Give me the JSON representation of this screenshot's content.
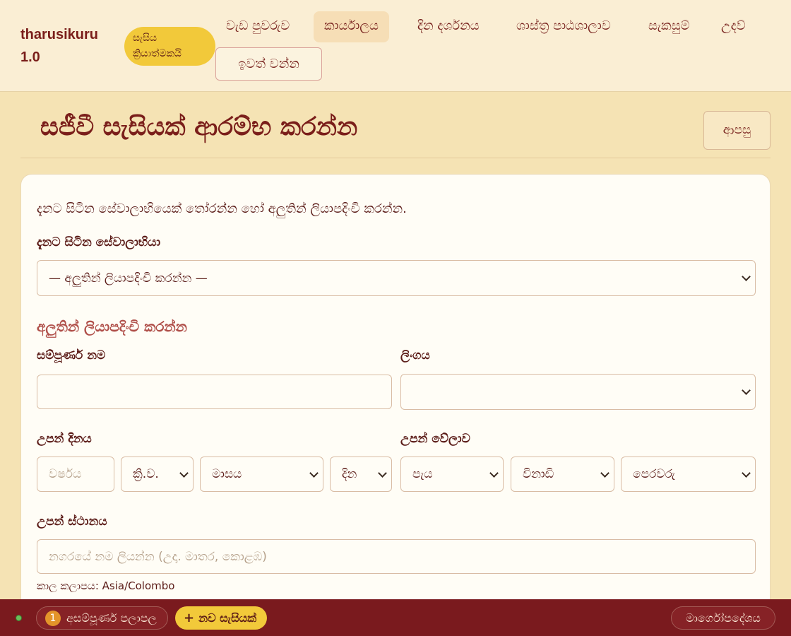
{
  "app": {
    "brand": "tharusikuru 1.0",
    "session_badge": "සැසිය ක්‍රියාත්මකයි"
  },
  "nav": {
    "items": [
      {
        "label": "වැඩ පුවරුව"
      },
      {
        "label": "කාර්යාලය",
        "active": true
      },
      {
        "label": "දින දර්ශනය"
      },
      {
        "label": "ශාස්ත්‍ර පාඨශාලාව"
      },
      {
        "label": "සැකසුම්"
      },
      {
        "label": "උදව්"
      }
    ],
    "logout_label": "ඉවත් වන්න"
  },
  "page": {
    "title": "සජීවී සැසියක් ආරම්භ කරන්න",
    "back_label": "ආපසු"
  },
  "form": {
    "intro": "දැනට සිටින සේවාලාභියෙක් තෝරන්න හෝ අලුතින් ලියාපදිංචි කරන්න.",
    "existing_client_label": "දැනට සිටින සේවාලාභියා",
    "existing_client_value": "— අලුතින් ලියාපදිංචි කරන්න —",
    "new_section_heading": "අලුතින් ලියාපදිංචි කරන්න",
    "full_name_label": "සම්පූර්ණ නම",
    "full_name_value": "",
    "gender_label": "ලිංගය",
    "gender_value": "",
    "birth_date_label": "උපන් දිනය",
    "year_placeholder": "වර්ෂය",
    "era_value": "ක්‍රි.ව.",
    "month_value": "මාසය",
    "day_value": "දින",
    "birth_time_label": "උපන් වේලාව",
    "hour_value": "පැය",
    "minute_value": "විනාඩි",
    "ampm_value": "පෙරවරු",
    "birth_place_label": "උපන් ස්ථානය",
    "birth_place_placeholder": "නගරයේ නම ලියන්න (උදා. මාතර, කොළඹ)",
    "timezone_label": "කාල කලාපය:",
    "timezone_value": "Asia/Colombo"
  },
  "footer": {
    "drafts_count": "1",
    "drafts_label": "අසම්පූර්ණ පලාපල",
    "new_session_label": "නව සැසියක්",
    "guide_label": "මාර්ගෝපදේශය"
  },
  "colors": {
    "accent": "#f2c93a",
    "brand": "#7a1e1a",
    "footer_bg": "#7a1a1e",
    "page_bg": "#f5e3b4",
    "status_online": "#6bbf5a"
  },
  "icons": {
    "status": "status-dot-icon",
    "select": "chevron-down-icon",
    "add": "plus-icon"
  }
}
